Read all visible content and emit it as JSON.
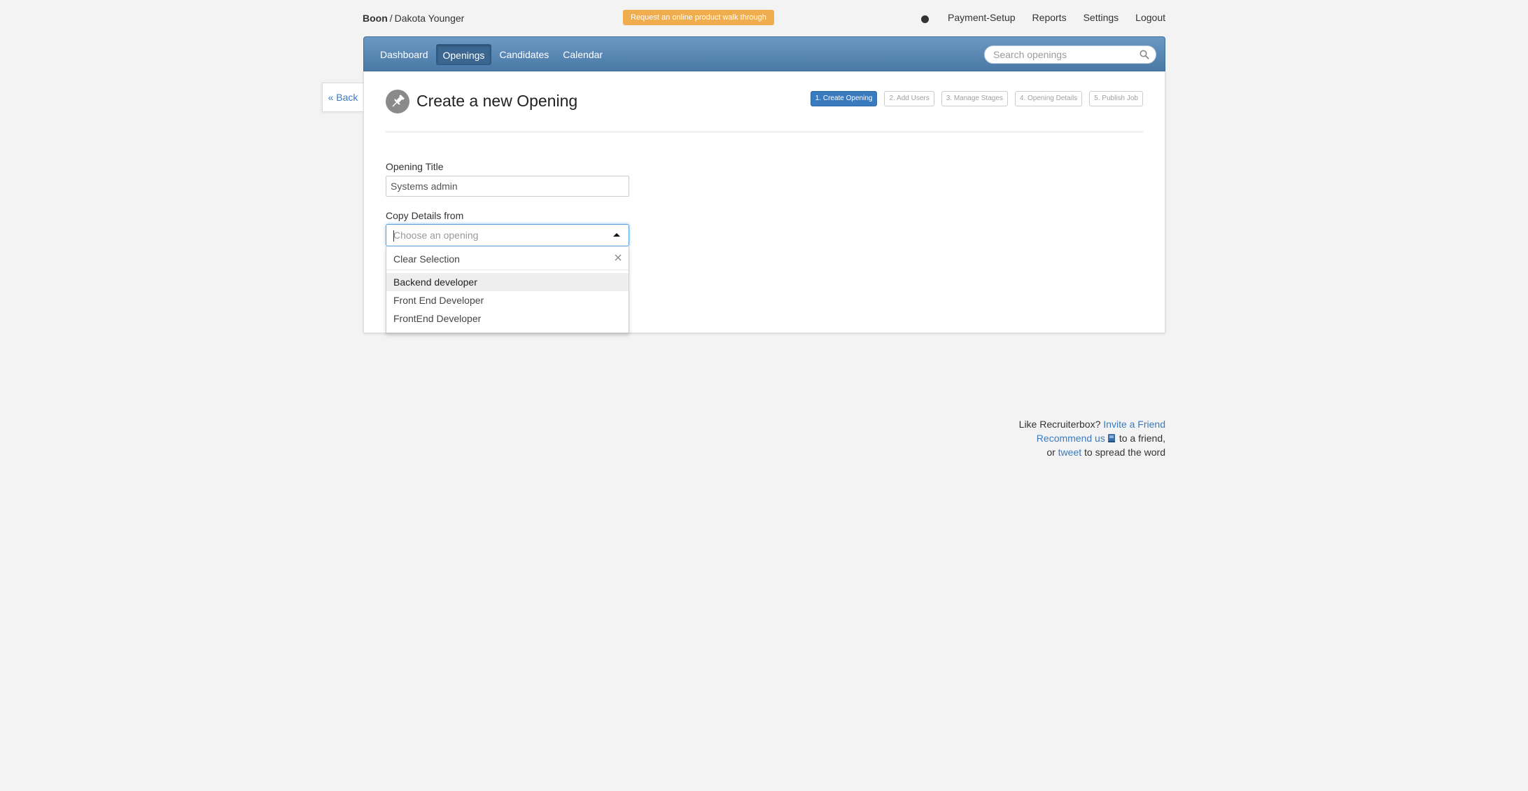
{
  "topbar": {
    "company": "Boon",
    "separator": "/",
    "user": "Dakota Younger",
    "walkthrough_label": "Request an online product walk through",
    "nav": {
      "payment_setup": "Payment-Setup",
      "reports": "Reports",
      "settings": "Settings",
      "logout": "Logout"
    }
  },
  "navbar": {
    "items": [
      {
        "label": "Dashboard",
        "active": false
      },
      {
        "label": "Openings",
        "active": true
      },
      {
        "label": "Candidates",
        "active": false
      },
      {
        "label": "Calendar",
        "active": false
      }
    ],
    "search": {
      "placeholder": "Search openings",
      "value": ""
    }
  },
  "back_label": "« Back",
  "page": {
    "title": "Create a new Opening",
    "steps": [
      {
        "label": "1. Create Opening",
        "active": true
      },
      {
        "label": "2. Add Users",
        "active": false
      },
      {
        "label": "3. Manage Stages",
        "active": false
      },
      {
        "label": "4. Opening Details",
        "active": false
      },
      {
        "label": "5. Publish Job",
        "active": false
      }
    ]
  },
  "form": {
    "opening_title_label": "Opening Title",
    "opening_title_value": "Systems admin",
    "copy_details_label": "Copy Details from",
    "copy_details_placeholder": "Choose an opening",
    "dropdown": {
      "clear_label": "Clear Selection",
      "options": [
        "Backend developer",
        "Front End Developer",
        "FrontEnd Developer"
      ],
      "highlighted_index": 0
    }
  },
  "footer": {
    "line1_text": "Like Recruiterbox?",
    "invite_link": "Invite a Friend",
    "recommend_link": "Recommend us",
    "line2_suffix": "to a friend,",
    "line3_prefix": "or",
    "tweet_link": "tweet",
    "line3_suffix": "to spread the word"
  },
  "colors": {
    "navbar": "#5a89b7",
    "accent": "#3a7bbf",
    "walkthrough": "#f0ad4e",
    "background": "#f3f3f3"
  }
}
